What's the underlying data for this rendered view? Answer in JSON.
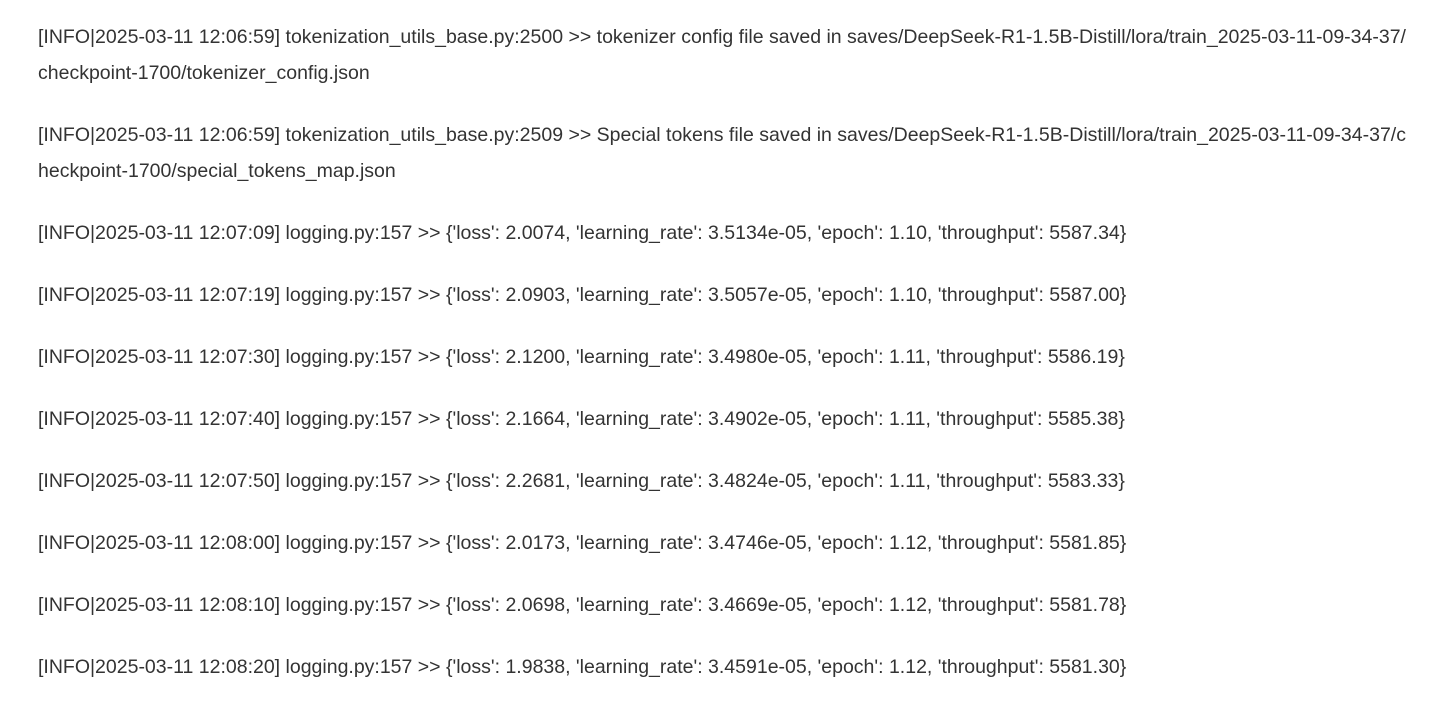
{
  "log": {
    "lines": [
      "[INFO|2025-03-11 12:06:59] tokenization_utils_base.py:2500 >> tokenizer config file saved in saves/DeepSeek-R1-1.5B-Distill/lora/train_2025-03-11-09-34-37/checkpoint-1700/tokenizer_config.json",
      "[INFO|2025-03-11 12:06:59] tokenization_utils_base.py:2509 >> Special tokens file saved in saves/DeepSeek-R1-1.5B-Distill/lora/train_2025-03-11-09-34-37/checkpoint-1700/special_tokens_map.json",
      "[INFO|2025-03-11 12:07:09] logging.py:157 >> {'loss': 2.0074, 'learning_rate': 3.5134e-05, 'epoch': 1.10, 'throughput': 5587.34}",
      "[INFO|2025-03-11 12:07:19] logging.py:157 >> {'loss': 2.0903, 'learning_rate': 3.5057e-05, 'epoch': 1.10, 'throughput': 5587.00}",
      "[INFO|2025-03-11 12:07:30] logging.py:157 >> {'loss': 2.1200, 'learning_rate': 3.4980e-05, 'epoch': 1.11, 'throughput': 5586.19}",
      "[INFO|2025-03-11 12:07:40] logging.py:157 >> {'loss': 2.1664, 'learning_rate': 3.4902e-05, 'epoch': 1.11, 'throughput': 5585.38}",
      "[INFO|2025-03-11 12:07:50] logging.py:157 >> {'loss': 2.2681, 'learning_rate': 3.4824e-05, 'epoch': 1.11, 'throughput': 5583.33}",
      "[INFO|2025-03-11 12:08:00] logging.py:157 >> {'loss': 2.0173, 'learning_rate': 3.4746e-05, 'epoch': 1.12, 'throughput': 5581.85}",
      "[INFO|2025-03-11 12:08:10] logging.py:157 >> {'loss': 2.0698, 'learning_rate': 3.4669e-05, 'epoch': 1.12, 'throughput': 5581.78}",
      "[INFO|2025-03-11 12:08:20] logging.py:157 >> {'loss': 1.9838, 'learning_rate': 3.4591e-05, 'epoch': 1.12, 'throughput': 5581.30}"
    ]
  }
}
